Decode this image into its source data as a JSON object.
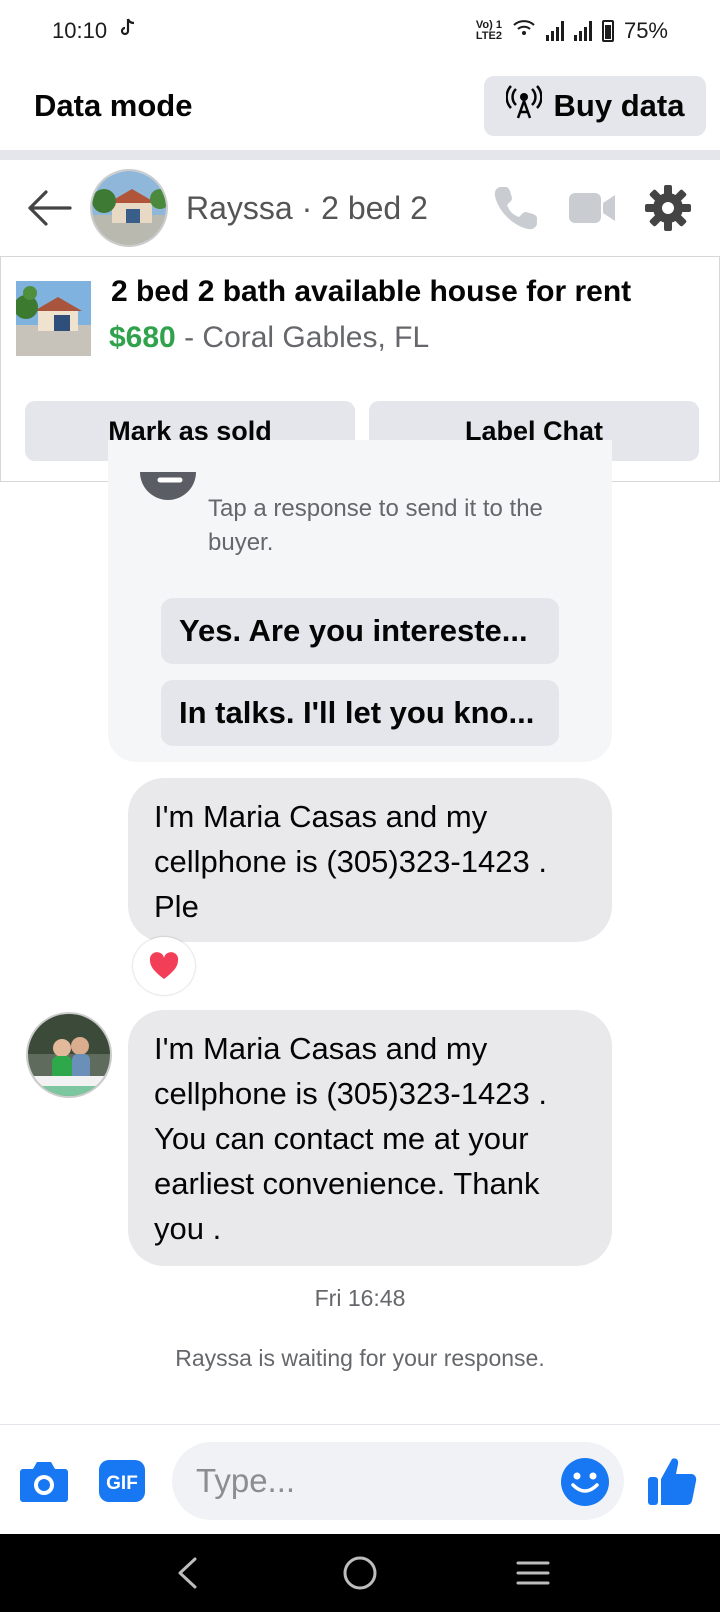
{
  "status_bar": {
    "time": "10:10",
    "network_label": "LTE2",
    "volte_label": "Vo) 1",
    "battery": "75%"
  },
  "data_mode": {
    "title": "Data mode",
    "buy_label": "Buy data"
  },
  "chat_header": {
    "name": "Rayssa · 2 bed 2"
  },
  "listing": {
    "title": "2 bed 2 bath available house for rent",
    "price": "$680",
    "location": " - Coral Gables, FL",
    "mark_sold_label": "Mark as sold",
    "label_chat_label": "Label Chat"
  },
  "suggestions": {
    "hint": "Tap a response to send it to the buyer.",
    "replies": [
      "Yes. Are you interested?",
      "In talks. I'll let you know."
    ],
    "replies_shown": [
      "Yes. Are you intereste...",
      "In talks. I'll let you kno..."
    ]
  },
  "messages": [
    {
      "text": "I'm Maria Casas and my cellphone is (305)323-1423 . Ple",
      "reaction": "heart"
    },
    {
      "text": "I'm Maria Casas and my cellphone is (305)323-1423 . You can contact me at your earliest convenience.  Thank you ."
    }
  ],
  "timestamp": "Fri 16:48",
  "waiting_text": "Rayssa is waiting for your response.",
  "composer": {
    "placeholder": "Type...",
    "gif_label": "GIF"
  },
  "colors": {
    "brand_blue": "#1877f2",
    "price_green": "#31a24c",
    "reaction_pink": "#f33e58"
  }
}
